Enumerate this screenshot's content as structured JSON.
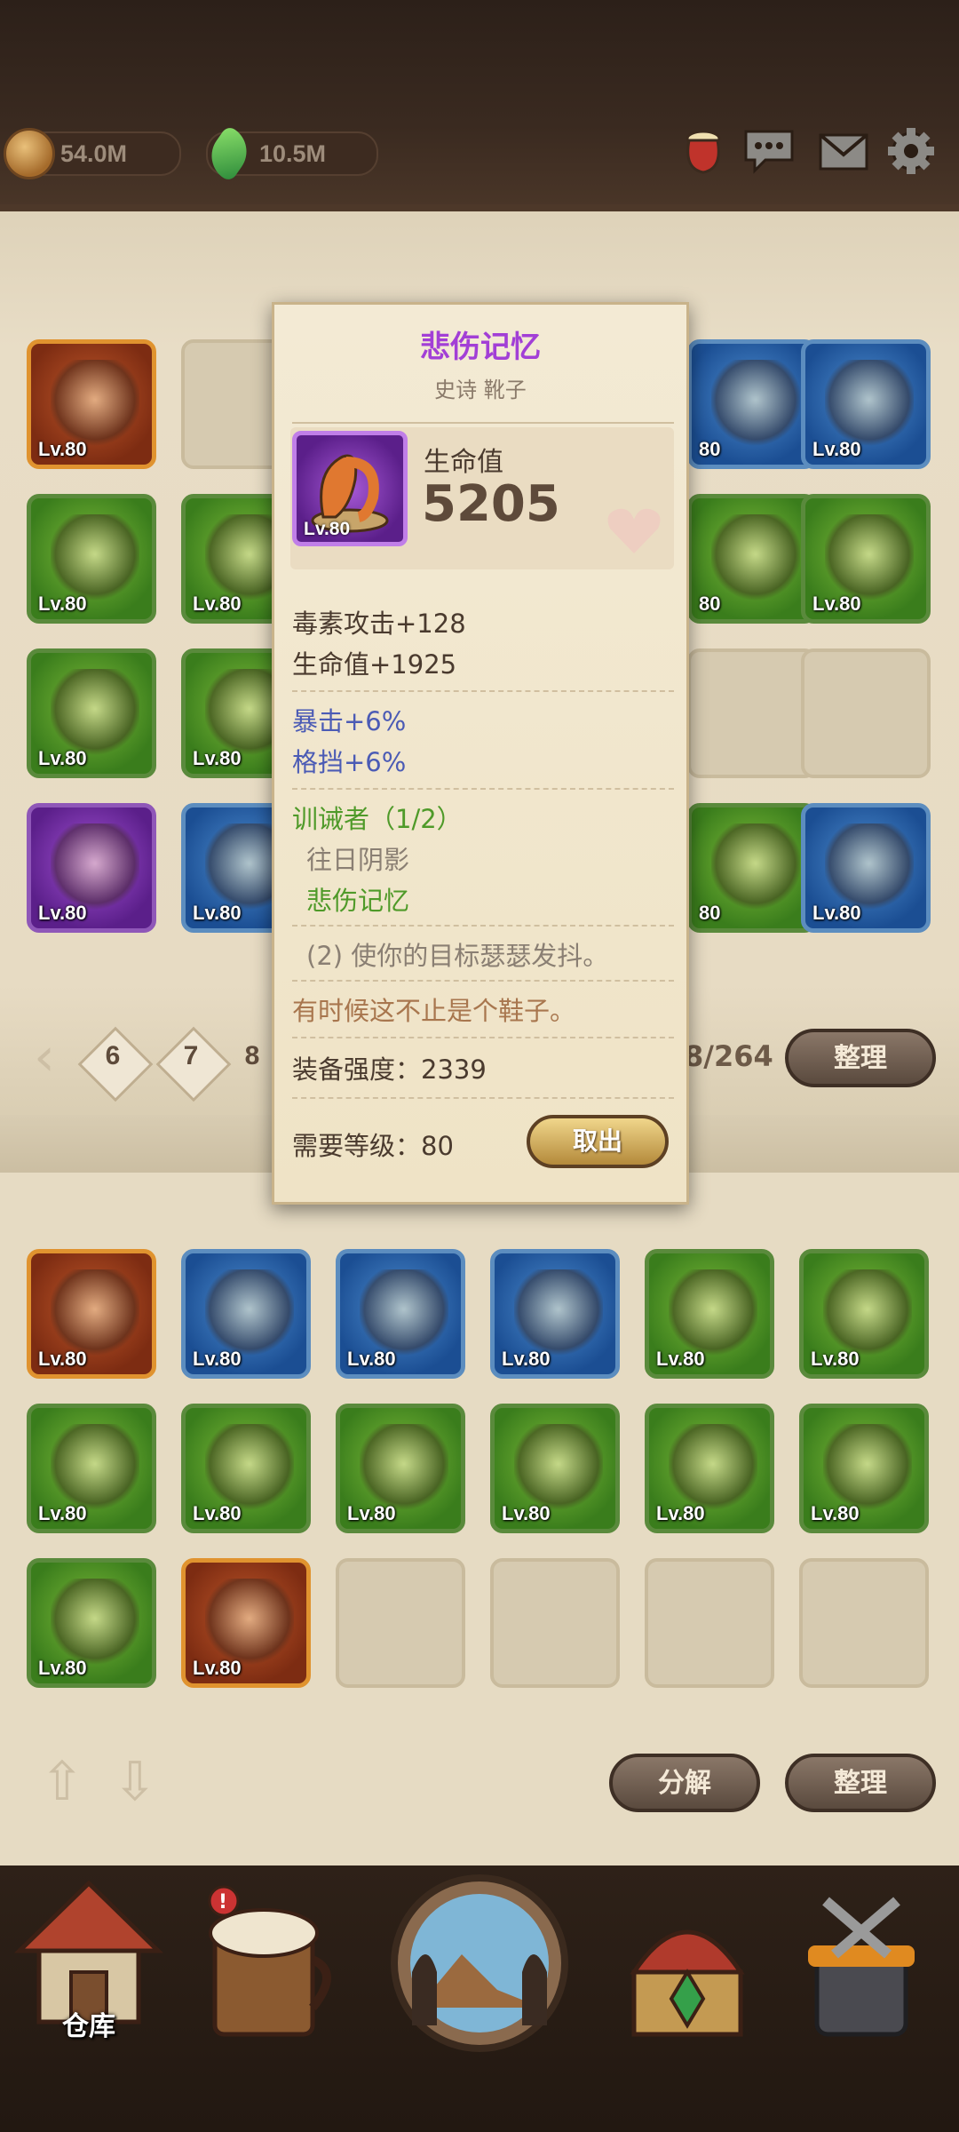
{
  "resources": {
    "coins": "54.0M",
    "gems": "10.5M"
  },
  "top_icons": [
    "potion-icon",
    "chat-icon",
    "mail-icon",
    "settings-icon"
  ],
  "storage_grid": {
    "page_numbers": [
      "6",
      "7",
      "8"
    ],
    "count": "8/264",
    "sort_label": "整理",
    "items": [
      {
        "level": "Lv.80",
        "rarity": "orange",
        "icon": "circlet-icon"
      },
      {
        "level": "",
        "rarity": "empty",
        "icon": ""
      },
      {
        "level": "80",
        "rarity": "blue",
        "icon": "chestplate-icon"
      },
      {
        "level": "Lv.80",
        "rarity": "blue",
        "icon": "ring-icon"
      },
      {
        "level": "Lv.80",
        "rarity": "green",
        "icon": "spears-icon"
      },
      {
        "level": "Lv.80",
        "rarity": "green",
        "icon": "helmet-icon"
      },
      {
        "level": "80",
        "rarity": "green",
        "icon": "skirt-icon"
      },
      {
        "level": "Lv.80",
        "rarity": "green",
        "icon": "gauntlet-icon"
      },
      {
        "level": "Lv.80",
        "rarity": "green",
        "icon": "boots-icon"
      },
      {
        "level": "Lv.80",
        "rarity": "green",
        "icon": "boots-icon"
      },
      {
        "level": "",
        "rarity": "empty",
        "icon": ""
      },
      {
        "level": "",
        "rarity": "empty",
        "icon": ""
      },
      {
        "level": "Lv.80",
        "rarity": "purple",
        "icon": "horn-icon"
      },
      {
        "level": "Lv.80",
        "rarity": "blue",
        "icon": "fur-boots-icon"
      },
      {
        "level": "80",
        "rarity": "green",
        "icon": "cloak-icon"
      },
      {
        "level": "Lv.80",
        "rarity": "blue",
        "icon": "bracelet-icon"
      }
    ]
  },
  "tooltip": {
    "name": "悲伤记忆",
    "subtitle": "史诗 靴子",
    "item_level": "Lv.80",
    "main_stat_label": "生命值",
    "main_stat_value": "5205",
    "base_stats": [
      "毒素攻击+128",
      "生命值+1925"
    ],
    "bonus_stats": [
      "暴击+6%",
      "格挡+6%"
    ],
    "set_name": "训诫者（1/2）",
    "set_items": [
      "往日阴影",
      "悲伤记忆"
    ],
    "set_bonus": "(2) 使你的目标瑟瑟发抖。",
    "flavor": "有时候这不止是个鞋子。",
    "gear_score": "装备强度：2339",
    "required_level": "需要等级：80",
    "take_out": "取出"
  },
  "bag_grid": {
    "decompose_label": "分解",
    "sort_label": "整理",
    "items": [
      {
        "level": "Lv.80",
        "rarity": "orange",
        "icon": "crossbow-icon"
      },
      {
        "level": "Lv.80",
        "rarity": "blue",
        "icon": "book-icon"
      },
      {
        "level": "Lv.80",
        "rarity": "blue",
        "icon": "knight-helmet-icon"
      },
      {
        "level": "Lv.80",
        "rarity": "blue",
        "icon": "eye-ring-icon"
      },
      {
        "level": "Lv.80",
        "rarity": "green",
        "icon": "staff-icon"
      },
      {
        "level": "Lv.80",
        "rarity": "green",
        "icon": "dagger-icon"
      },
      {
        "level": "Lv.80",
        "rarity": "green",
        "icon": "orb-icon"
      },
      {
        "level": "Lv.80",
        "rarity": "green",
        "icon": "feather-hat-icon"
      },
      {
        "level": "Lv.80",
        "rarity": "green",
        "icon": "nasal-helmet-icon"
      },
      {
        "level": "Lv.80",
        "rarity": "green",
        "icon": "amulet-icon"
      },
      {
        "level": "Lv.80",
        "rarity": "green",
        "icon": "dark-cloak-icon"
      },
      {
        "level": "Lv.80",
        "rarity": "green",
        "icon": "yellow-cape-icon"
      },
      {
        "level": "Lv.80",
        "rarity": "green",
        "icon": "glove-icon"
      },
      {
        "level": "Lv.80",
        "rarity": "orange",
        "icon": "flail-icon"
      },
      {
        "level": "",
        "rarity": "empty",
        "icon": ""
      },
      {
        "level": "",
        "rarity": "empty",
        "icon": ""
      },
      {
        "level": "",
        "rarity": "empty",
        "icon": ""
      },
      {
        "level": "",
        "rarity": "empty",
        "icon": ""
      }
    ]
  },
  "bottom_nav": {
    "warehouse_label": "仓库",
    "items": [
      "warehouse-icon",
      "tavern-icon",
      "adventure-icon",
      "treasure-icon",
      "forge-icon"
    ]
  },
  "colors": {
    "epic": "#a23fd6",
    "set_green": "#4f9a29",
    "bonus_blue": "#4b5bb5",
    "flavor_brown": "#a8764e"
  }
}
